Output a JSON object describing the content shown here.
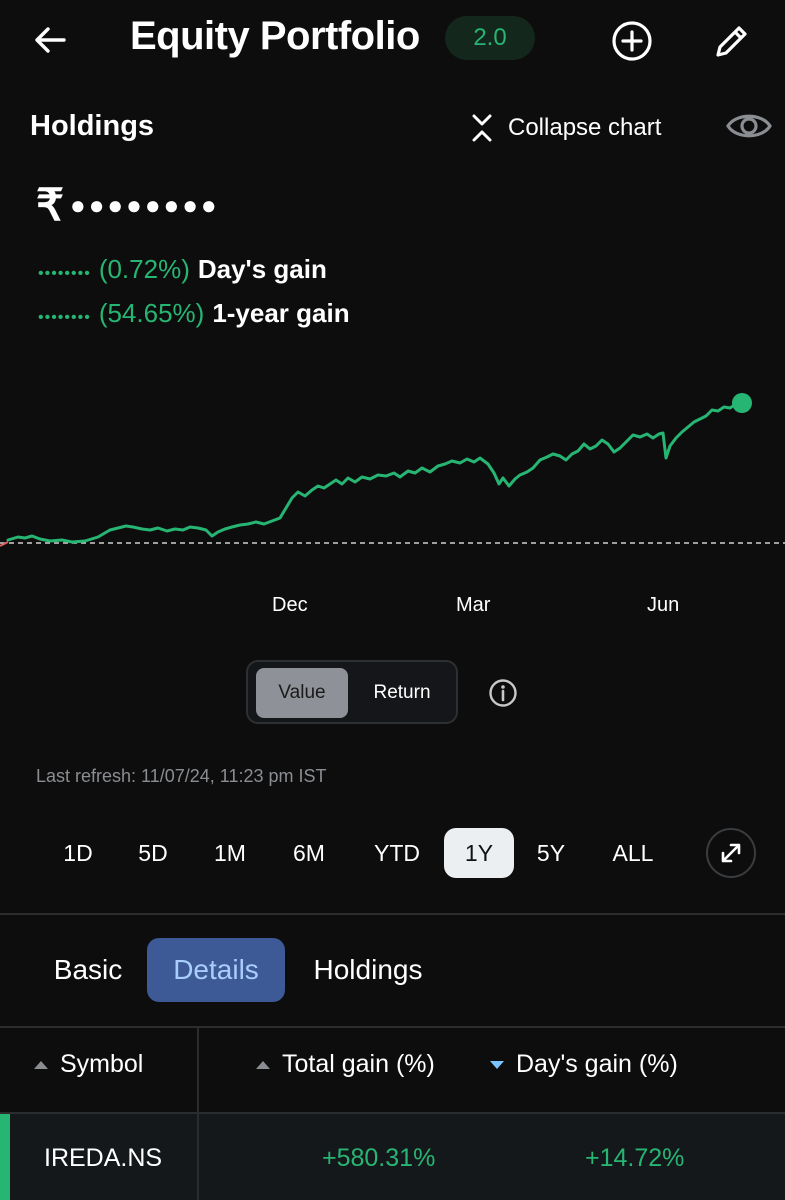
{
  "header": {
    "title": "Equity Portfolio",
    "version_badge": "2.0"
  },
  "summary": {
    "section_title": "Holdings",
    "collapse_label": "Collapse chart",
    "currency_symbol": "₹",
    "masked_value": "●●●●●●●●",
    "days_gain_masked": "••••••••",
    "days_gain_pct": "(0.72%)",
    "days_gain_label": "Day's gain",
    "year_gain_masked": "••••••••",
    "year_gain_pct": "(54.65%)",
    "year_gain_label": "1-year gain"
  },
  "chart_data": {
    "type": "line",
    "tick_labels": [
      "Dec",
      "Mar",
      "Jun"
    ],
    "baseline": "dashed",
    "line_color": "#27b573"
  },
  "chart_toggle": {
    "value_label": "Value",
    "return_label": "Return",
    "selected": "Value"
  },
  "refresh_text": "Last refresh: 11/07/24, 11:23 pm IST",
  "ranges": {
    "items": [
      "1D",
      "5D",
      "1M",
      "6M",
      "YTD",
      "1Y",
      "5Y",
      "ALL"
    ],
    "selected": "1Y"
  },
  "tabs": {
    "items": [
      "Basic",
      "Details",
      "Holdings"
    ],
    "selected": "Details"
  },
  "table": {
    "headers": [
      "Symbol",
      "Total gain (%)",
      "Day's gain (%)"
    ],
    "rows": [
      {
        "symbol": "IREDA.NS",
        "total_gain": "+580.31%",
        "days_gain": "+14.72%"
      }
    ]
  },
  "colors": {
    "accent_green": "#27b573",
    "active_tab_bg": "#3d5a97",
    "active_tab_text": "#a9cdfd"
  }
}
